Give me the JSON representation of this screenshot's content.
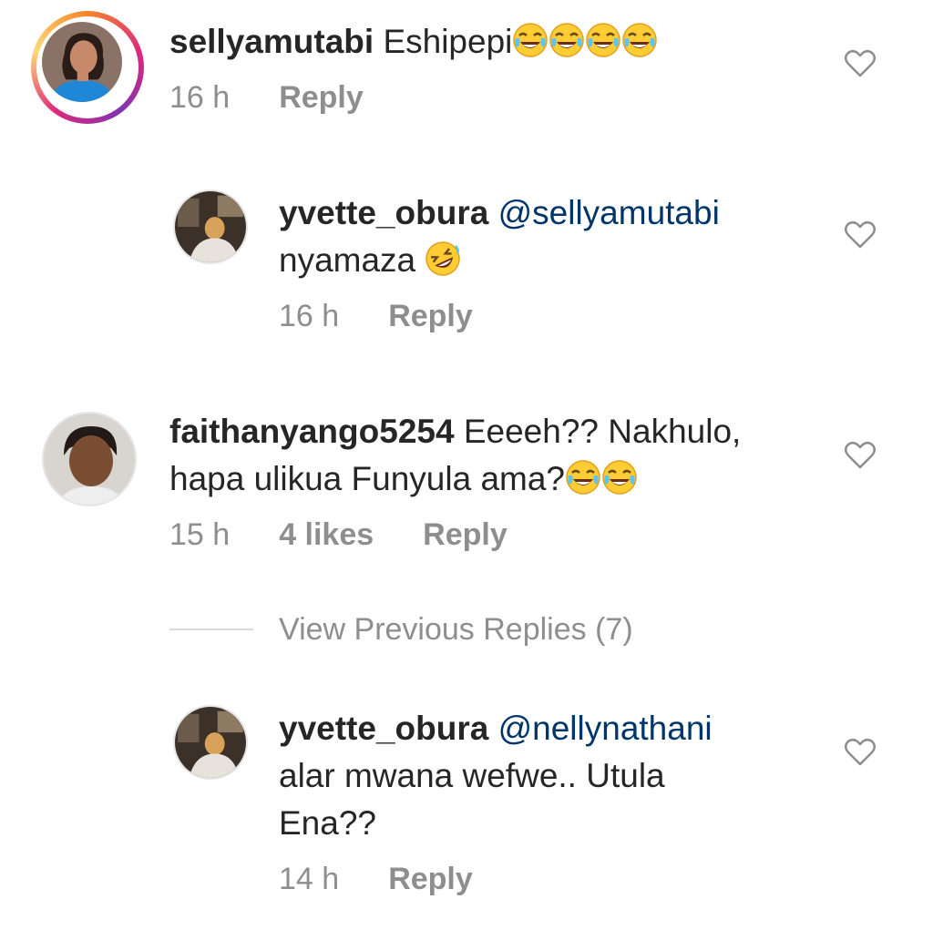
{
  "comments": [
    {
      "username": "sellyamutabi",
      "text": "Eshipepi",
      "emojis": [
        "face-with-tears-of-joy",
        "face-with-tears-of-joy",
        "face-with-tears-of-joy",
        "face-with-tears-of-joy"
      ],
      "time": "16 h",
      "reply_label": "Reply",
      "avatar_icon": "profile-photo-woman",
      "has_story_ring": true
    },
    {
      "username": "yvette_obura",
      "mention": "@sellyamutabi",
      "text": "nyamaza",
      "emojis": [
        "rolling-on-floor-laughing"
      ],
      "time": "16 h",
      "reply_label": "Reply",
      "avatar_icon": "profile-photo-dark"
    },
    {
      "username": "faithanyango5254",
      "text_line1": "Eeeeh?? Nakhulo,",
      "text_line2": "hapa ulikua Funyula ama?",
      "emojis": [
        "face-with-tears-of-joy",
        "face-with-tears-of-joy"
      ],
      "time": "15 h",
      "likes": "4 likes",
      "reply_label": "Reply",
      "avatar_icon": "profile-photo-child"
    },
    {
      "username": "yvette_obura",
      "mention": "@nellynathani",
      "text_line1": "alar mwana wefwe.. Utula",
      "text_line2": "Ena??",
      "time": "14 h",
      "reply_label": "Reply",
      "avatar_icon": "profile-photo-dark"
    }
  ],
  "view_previous_replies": "View Previous Replies (7)",
  "colors": {
    "text": "#262626",
    "meta": "#8e8e8e",
    "mention": "#003569",
    "divider": "#dbdbdb"
  }
}
